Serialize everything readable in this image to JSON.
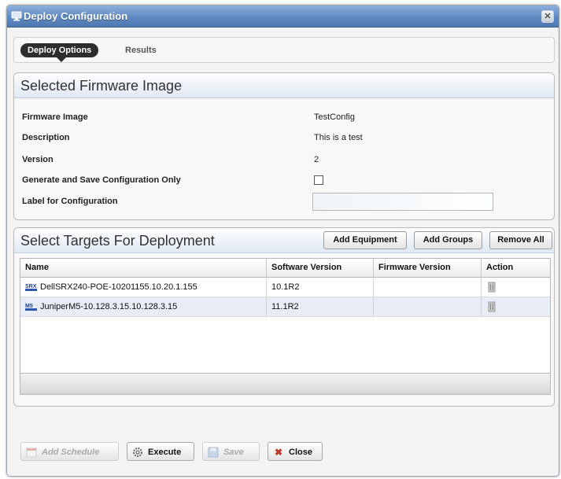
{
  "window": {
    "title": "Deploy Configuration",
    "close_glyph": "✕"
  },
  "tabs": [
    {
      "label": "Deploy Options",
      "active": true
    },
    {
      "label": "Results",
      "active": false
    }
  ],
  "firmware_section": {
    "title": "Selected Firmware Image",
    "fields": [
      {
        "label": "Firmware Image",
        "value": "TestConfig"
      },
      {
        "label": "Description",
        "value": "This is a test"
      },
      {
        "label": "Version",
        "value": "2"
      },
      {
        "label": "Generate and Save Configuration Only",
        "checked": false
      },
      {
        "label": "Label for Configuration",
        "value": ""
      }
    ]
  },
  "targets_section": {
    "title": "Select Targets For Deployment",
    "buttons": {
      "add_equipment": "Add Equipment",
      "add_groups": "Add Groups",
      "remove_all": "Remove All"
    },
    "columns": [
      "Name",
      "Software Version",
      "Firmware Version",
      "Action"
    ],
    "rows": [
      {
        "icon_label": "SRX",
        "name": "DellSRX240-POE-10201155.10.20.1.155",
        "software_version": "10.1R2",
        "firmware_version": "",
        "action_icon": "delete-icon"
      },
      {
        "icon_label": "M5",
        "name": "JuniperM5-10.128.3.15.10.128.3.15",
        "software_version": "11.1R2",
        "firmware_version": "",
        "action_icon": "delete-icon"
      }
    ]
  },
  "footer_buttons": {
    "add_schedule": "Add Schedule",
    "execute": "Execute",
    "save": "Save",
    "close": "Close"
  },
  "colors": {
    "title_bar": "#5f89c2",
    "active_tab": "#2d2d2d",
    "close_x": "#c0392b",
    "selected_row": "#e8ecf6"
  }
}
